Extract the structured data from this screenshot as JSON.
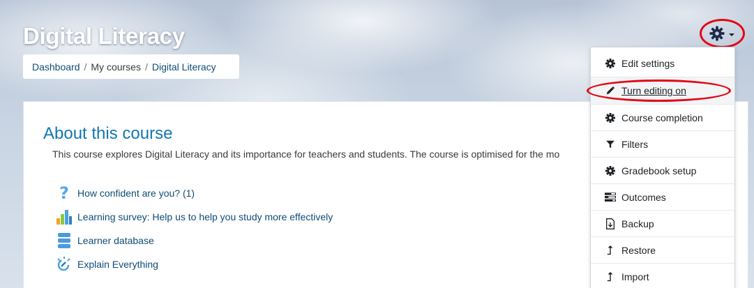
{
  "header": {
    "title": "Digital Literacy"
  },
  "breadcrumb": {
    "items": [
      "Dashboard",
      "My courses",
      "Digital Literacy"
    ],
    "separator": "/"
  },
  "course": {
    "about_title": "About this course",
    "summary": "This course explores Digital Literacy and its importance for teachers and students. The course is optimised for the mo",
    "activities": [
      {
        "label": "How confident are you? (1)",
        "icon": "question-icon"
      },
      {
        "label": "Learning survey: Help us to help you study more effectively",
        "icon": "survey-chart-icon"
      },
      {
        "label": "Learner database",
        "icon": "database-icon"
      },
      {
        "label": "Explain Everything",
        "icon": "explain-icon"
      }
    ]
  },
  "settings_menu": {
    "toggle_icon": "gear-icon",
    "items": [
      {
        "label": "Edit settings",
        "icon": "gear-icon"
      },
      {
        "label": "Turn editing on",
        "icon": "pencil-icon",
        "highlighted": true
      },
      {
        "label": "Course completion",
        "icon": "gear-icon"
      },
      {
        "label": "Filters",
        "icon": "filter-icon"
      },
      {
        "label": "Gradebook setup",
        "icon": "gear-icon"
      },
      {
        "label": "Outcomes",
        "icon": "outcomes-icon"
      },
      {
        "label": "Backup",
        "icon": "backup-icon"
      },
      {
        "label": "Restore",
        "icon": "upload-icon"
      },
      {
        "label": "Import",
        "icon": "upload-icon"
      }
    ]
  },
  "colors": {
    "link": "#0f4c75",
    "heading": "#1177b2",
    "highlight_ring": "#e30613"
  }
}
